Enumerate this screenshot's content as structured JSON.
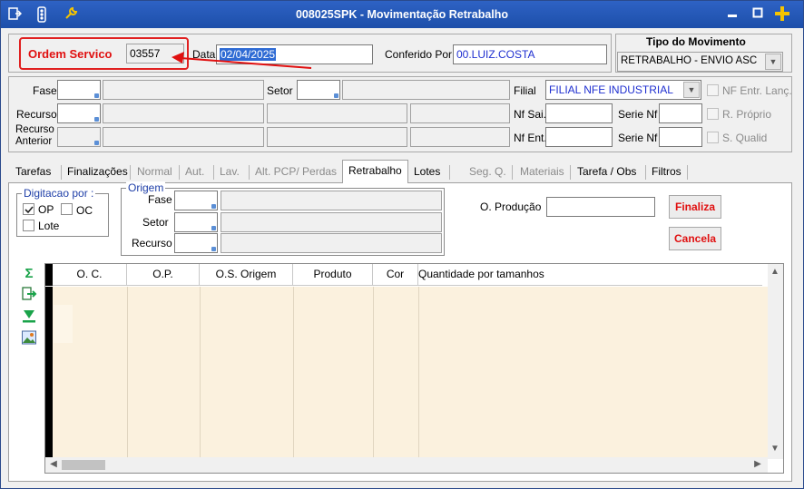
{
  "window": {
    "title": "008025SPK - Movimentação Retrabalho",
    "min_symbol": "▬",
    "max_symbol": "□",
    "plus_symbol": "+"
  },
  "header": {
    "ordem_label": "Ordem Servico",
    "ordem_value": "03557",
    "data_label": "Data",
    "data_value": "02/04/2025",
    "conferido_label": "Conferido Por",
    "conferido_value": "00.LUIZ.COSTA",
    "tipo_label": "Tipo do Movimento",
    "tipo_value": "RETRABALHO - ENVIO ASC"
  },
  "fields": {
    "fase_label": "Fase",
    "setor_label": "Setor",
    "filial_label": "Filial",
    "filial_value": "FILIAL NFE INDUSTRIAL",
    "nf_entr_label": "NF Entr. Lanç.",
    "recurso_label": "Recurso",
    "nf_sai_label": "Nf Sai.",
    "serie_nf_label": "Serie Nf",
    "r_proprio_label": "R. Próprio",
    "recurso_anterior_label_1": "Recurso",
    "recurso_anterior_label_2": "Anterior",
    "nf_ent_label": "Nf Ent.",
    "serie_nf2_label": "Serie Nf",
    "s_qualid_label": "S. Qualid"
  },
  "tabs": [
    {
      "label": "Tarefas"
    },
    {
      "label": "Finalizações"
    },
    {
      "label": "Normal"
    },
    {
      "label": "Aut."
    },
    {
      "label": "Lav."
    },
    {
      "label": "Alt. PCP/ Perdas"
    },
    {
      "label": "Retrabalho"
    },
    {
      "label": "Lotes"
    },
    {
      "label": "Seg. Q."
    },
    {
      "label": "Materiais"
    },
    {
      "label": "Tarefa / Obs"
    },
    {
      "label": "Filtros"
    }
  ],
  "retrabalho": {
    "digitacao_title": "Digitacao por :",
    "op_label": "OP",
    "oc_label": "OC",
    "lote_label": "Lote",
    "origem_title": "Origem",
    "origem_fase_label": "Fase",
    "origem_setor_label": "Setor",
    "origem_recurso_label": "Recurso",
    "o_producao_label": "O. Produção",
    "finaliza_label": "Finaliza",
    "cancela_label": "Cancela"
  },
  "grid": {
    "columns": [
      "O. C.",
      "O.P.",
      "O.S. Origem",
      "Produto",
      "Cor",
      "Quantidade por tamanhos"
    ]
  },
  "icons": {
    "sum": "Σ",
    "export": "⇨",
    "down": "⏬",
    "image": "▣"
  },
  "colors": {
    "title_bar": "#1d4faa",
    "accent_red": "#e01010",
    "grid_body": "#fbf1de",
    "value_blue": "#1f2fd0"
  }
}
